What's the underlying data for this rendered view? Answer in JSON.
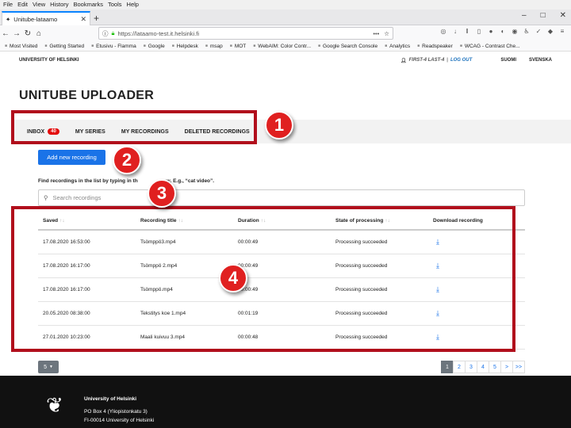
{
  "browser": {
    "menu": [
      "File",
      "Edit",
      "View",
      "History",
      "Bookmarks",
      "Tools",
      "Help"
    ],
    "tab_title": "Unitube-lataamo",
    "url": "https://lataamo-test.it.helsinki.fi",
    "bookmarks": [
      "Most Visited",
      "Getting Started",
      "Etusivu - Flamma",
      "Google",
      "Helpdesk",
      "msap",
      "MOT",
      "WebAIM: Color Contr...",
      "Google Search Console",
      "Analytics",
      "Readspeaker",
      "WCAG - Contrast Che..."
    ]
  },
  "header": {
    "brand": "UNIVERSITY OF HELSINKI",
    "user": "FIRST-4 LAST-4",
    "logout": "LOG OUT",
    "lang_fi": "SUOMI",
    "lang_sv": "SVENSKA"
  },
  "app_title": "UNITUBE UPLOADER",
  "nav": {
    "inbox": "INBOX",
    "inbox_count": "40",
    "my_series": "MY SERIES",
    "my_recordings": "MY RECORDINGS",
    "deleted_recordings": "DELETED RECORDINGS"
  },
  "add_button": "Add new recording",
  "find_hint": "Find recordings in the list by typing in th",
  "find_hint_tail": "ow. E.g., “cat video”.",
  "search_placeholder": "Search recordings",
  "table": {
    "headers": [
      "Saved",
      "Recording title",
      "Duration",
      "State of processing",
      "Download recording"
    ],
    "rows": [
      {
        "saved": "17.08.2020 16:53:00",
        "title": "Tsömppö3.mp4",
        "duration": "00:00:49",
        "state": "Processing succeeded"
      },
      {
        "saved": "17.08.2020 16:17:00",
        "title": "Tsömppö 2.mp4",
        "duration": "00:00:49",
        "state": "Processing succeeded"
      },
      {
        "saved": "17.08.2020 16:17:00",
        "title": "Tsömppö.mp4",
        "duration": "00:00:49",
        "state": "Processing succeeded"
      },
      {
        "saved": "20.05.2020 08:38:00",
        "title": "Tekstitys koe 1.mp4",
        "duration": "00:01:19",
        "state": "Processing succeeded"
      },
      {
        "saved": "27.01.2020 10:23:00",
        "title": "Maali kuivuu 3.mp4",
        "duration": "00:00:48",
        "state": "Processing succeeded"
      }
    ]
  },
  "page_size": "5",
  "pager": [
    "1",
    "2",
    "3",
    "4",
    "5",
    ">",
    ">>"
  ],
  "footer": {
    "name": "University of Helsinki",
    "address1": "PO Box 4 (Yliopistonkatu 3)",
    "address2": "FI-00014 University of Helsinki"
  },
  "annotations": [
    "1",
    "2",
    "3",
    "4"
  ],
  "colors": {
    "annotation": "#e02020",
    "primary": "#1a73e8",
    "badge": "#e30b0b"
  }
}
